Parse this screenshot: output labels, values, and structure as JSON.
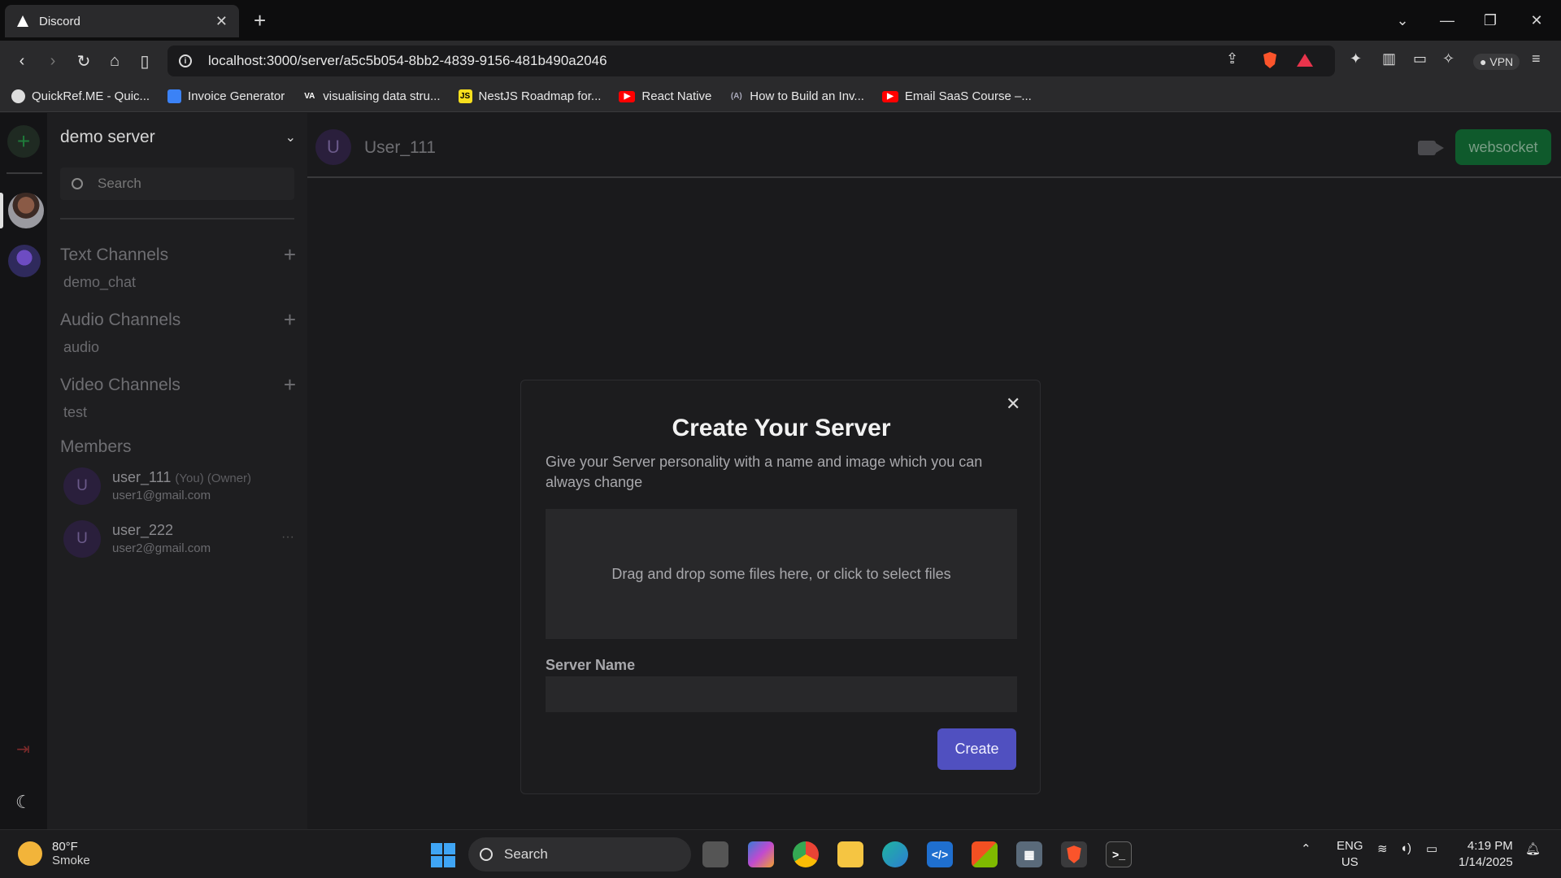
{
  "browser": {
    "tab_title": "Discord",
    "url": "localhost:3000/server/a5c5b054-8bb2-4839-9156-481b490a2046",
    "vpn_label": "VPN",
    "bookmarks": [
      {
        "label": "QuickRef.ME - Quic...",
        "icon": "globe-icon",
        "color": "#dddddd"
      },
      {
        "label": "Invoice Generator",
        "icon": "doc-icon",
        "color": "#3b82f6"
      },
      {
        "label": "visualising data stru...",
        "icon": "va-icon",
        "color": "#ffffff"
      },
      {
        "label": "NestJS Roadmap for...",
        "icon": "js-icon",
        "color": "#f7df1e"
      },
      {
        "label": "React Native",
        "icon": "youtube-icon",
        "color": "#ff0000"
      },
      {
        "label": "How to Build an Inv...",
        "icon": "a-icon",
        "color": "#8888aa"
      },
      {
        "label": "Email SaaS Course –...",
        "icon": "youtube-icon",
        "color": "#ff0000"
      }
    ]
  },
  "sidebar": {
    "server_name": "demo server",
    "search_placeholder": "Search",
    "sections": [
      {
        "title": "Text Channels",
        "channels": [
          "demo_chat"
        ]
      },
      {
        "title": "Audio Channels",
        "channels": [
          "audio"
        ]
      },
      {
        "title": "Video Channels",
        "channels": [
          "test"
        ]
      }
    ],
    "members_title": "Members",
    "members": [
      {
        "initial": "U",
        "name": "user_111",
        "tag": "(You) (Owner)",
        "email": "user1@gmail.com"
      },
      {
        "initial": "U",
        "name": "user_222",
        "tag": "",
        "email": "user2@gmail.com"
      }
    ]
  },
  "header": {
    "avatar_initial": "U",
    "username": "User_111",
    "socket_label": "websocket",
    "socket_color": "#0f5a2c"
  },
  "modal": {
    "title": "Create Your Server",
    "description": "Give your Server personality with a name and image which you can always change",
    "dropzone_text": "Drag and drop some files here, or click to select files",
    "field_label": "Server Name",
    "field_value": "",
    "button_label": "Create",
    "button_color": "#5050c0"
  },
  "taskbar": {
    "temperature": "80°F",
    "weather": "Smoke",
    "search_label": "Search",
    "lang_top": "ENG",
    "lang_bottom": "US",
    "time": "4:19 PM",
    "date": "1/14/2025"
  }
}
